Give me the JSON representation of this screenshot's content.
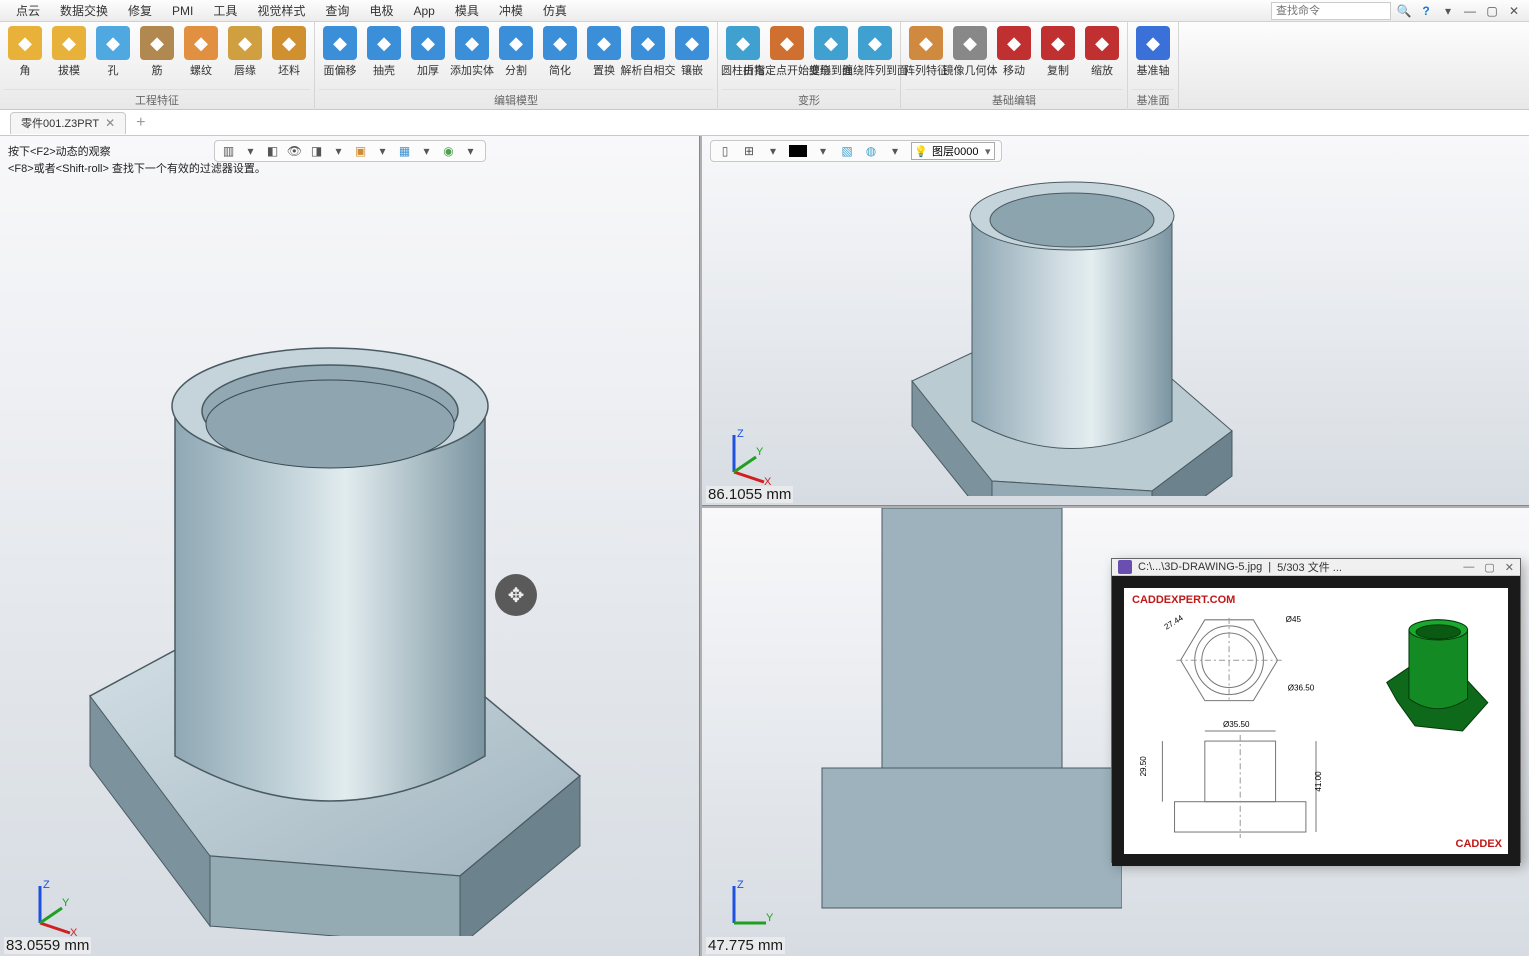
{
  "menu": {
    "items": [
      "点云",
      "数据交换",
      "修复",
      "PMI",
      "工具",
      "视觉样式",
      "查询",
      "电极",
      "App",
      "模具",
      "冲模",
      "仿真"
    ],
    "search_placeholder": "查找命令"
  },
  "ribbon": {
    "groups": [
      {
        "label": "工程特征",
        "buttons": [
          {
            "label": "角",
            "color": "#E8B23A"
          },
          {
            "label": "拔模",
            "color": "#E8B23A"
          },
          {
            "label": "孔",
            "color": "#4FA8E0"
          },
          {
            "label": "筋",
            "color": "#B08850"
          },
          {
            "label": "螺纹",
            "color": "#E09040"
          },
          {
            "label": "唇缘",
            "color": "#D0A040"
          },
          {
            "label": "坯料",
            "color": "#D09030"
          }
        ]
      },
      {
        "label": "编辑模型",
        "buttons": [
          {
            "label": "面偏移",
            "color": "#3A8FD8"
          },
          {
            "label": "抽壳",
            "color": "#3A8FD8"
          },
          {
            "label": "加厚",
            "color": "#3A8FD8"
          },
          {
            "label": "添加实体",
            "color": "#3A8FD8"
          },
          {
            "label": "分割",
            "color": "#3A8FD8"
          },
          {
            "label": "简化",
            "color": "#3A8FD8"
          },
          {
            "label": "置换",
            "color": "#3A8FD8"
          },
          {
            "label": "解析自相交",
            "color": "#3A8FD8"
          },
          {
            "label": "镶嵌",
            "color": "#3A8FD8"
          }
        ]
      },
      {
        "label": "变形",
        "buttons": [
          {
            "label": "圆柱折弯",
            "color": "#40A0D0"
          },
          {
            "label": "由指定点开始变形",
            "color": "#D07030"
          },
          {
            "label": "缠绕到面",
            "color": "#40A0D0"
          },
          {
            "label": "缠绕阵列到面",
            "color": "#40A0D0"
          }
        ]
      },
      {
        "label": "基础编辑",
        "buttons": [
          {
            "label": "阵列特征",
            "color": "#D08A40"
          },
          {
            "label": "镜像几何体",
            "color": "#888"
          },
          {
            "label": "移动",
            "color": "#C03030"
          },
          {
            "label": "复制",
            "color": "#C03030"
          },
          {
            "label": "缩放",
            "color": "#C03030"
          }
        ]
      },
      {
        "label": "基准面",
        "buttons": [
          {
            "label": "基准轴",
            "color": "#3A70D8"
          }
        ]
      }
    ]
  },
  "tabs": {
    "doc_name": "零件001.Z3PRT"
  },
  "hints": {
    "line1": "按下<F2>动态的观察",
    "line2": "<F8>或者<Shift-roll> 查找下一个有效的过滤器设置。"
  },
  "viewports": {
    "left_measure": "83.0559 mm",
    "tr_measure": "86.1055 mm",
    "br_measure": "47.775 mm",
    "layer_label": "图层0000"
  },
  "ref": {
    "title_path": "C:\\...\\3D-DRAWING-5.jpg",
    "title_pos": "5/303 文件 ...",
    "brand": "CADDEXPERT.COM",
    "dim_d45": "Ø45",
    "dim_d3650": "Ø36.50",
    "dim_d3550": "Ø35.50",
    "dim_2744": "27.44",
    "dim_2950": "29.50",
    "dim_4100": "41.00"
  }
}
